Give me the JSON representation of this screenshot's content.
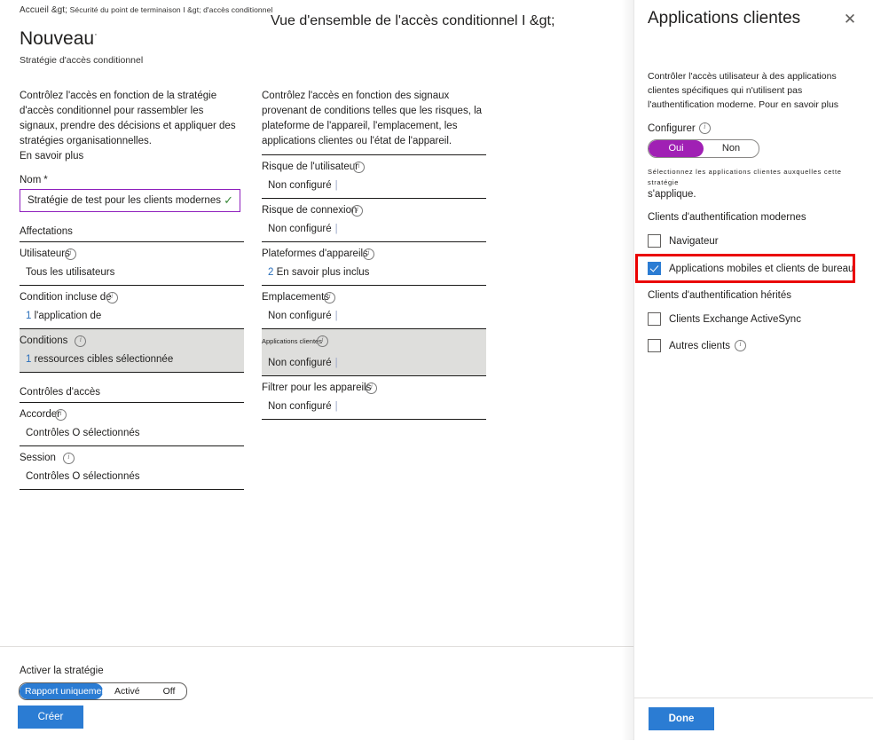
{
  "breadcrumb": {
    "home": "Accueil &gt;",
    "path": "Sécurité du point de terminaison I &gt; d'accès conditionnel"
  },
  "overview_title": "Vue d'ensemble de l'accès conditionnel I &gt;",
  "page": {
    "title": "Nouveau",
    "subtitle": "Stratégie d'accès conditionnel"
  },
  "left": {
    "description": "Contrôlez l'accès en fonction de la stratégie d'accès conditionnel pour rassembler les signaux, prendre des décisions et appliquer des stratégies organisationnelles.",
    "learn_more": "En savoir plus",
    "name_label": "Nom",
    "name_required": "*",
    "name_value": "Stratégie de test pour les clients modernes",
    "name_valid_icon": "checkmark-icon",
    "assignments_title": "Affectations",
    "rows": [
      {
        "label": "Utilisateurs",
        "value": "Tous les utilisateurs",
        "count": ""
      },
      {
        "label": "Condition incluse de",
        "value": "l'application de",
        "count": "1"
      },
      {
        "label": "Conditions",
        "value": "ressources cibles sélectionnée",
        "count": "1"
      }
    ],
    "access_controls_title": "Contrôles d'accès",
    "control_rows": [
      {
        "label": "Accorder",
        "value": "Contrôles O sélectionnés",
        "count": ""
      },
      {
        "label": "Session",
        "value": "Contrôles O sélectionnés",
        "count": ""
      }
    ]
  },
  "middle": {
    "description": "Contrôlez l'accès en fonction des signaux provenant de conditions telles que les risques, la plateforme de l'appareil, l'emplacement, les applications clientes ou l'état de l'appareil.",
    "rows": [
      {
        "label": "Risque de l'utilisateur",
        "value": "Non configuré",
        "count": "",
        "highlighted": false
      },
      {
        "label": "Risque de connexion",
        "value": "Non configuré",
        "count": "",
        "highlighted": false
      },
      {
        "label": "Plateformes d'appareils",
        "value": "En savoir plus inclus",
        "count": "2",
        "highlighted": false
      },
      {
        "label": "Emplacements",
        "value": "Non configuré",
        "count": "",
        "highlighted": false
      },
      {
        "label": "Applications clientes",
        "value": "Non configuré",
        "count": "",
        "highlighted": true
      },
      {
        "label": "Filtrer pour les appareils",
        "value": "Non configuré",
        "count": "",
        "highlighted": false
      }
    ]
  },
  "footer": {
    "enable_label": "Activer la stratégie",
    "segments": [
      "Rapport uniquement",
      "Activé",
      "Off"
    ],
    "selected_segment": "Rapport uniquement",
    "create_label": "Créer"
  },
  "panel": {
    "title": "Applications clientes",
    "close_icon": "close-icon",
    "description": "Contrôler l'accès utilisateur à des applications clientes spécifiques qui n'utilisent pas l'authentification moderne. Pour en savoir plus",
    "configure_label": "Configurer",
    "toggle": {
      "on": "Oui",
      "off": "Non",
      "selected": "Oui"
    },
    "hint_line1": "Sélectionnez les applications clientes auxquelles cette stratégie",
    "hint_line2": "s'applique.",
    "group_modern": "Clients d'authentification modernes",
    "group_legacy": "Clients d'authentification hérités",
    "checkboxes": [
      {
        "label": "Navigateur",
        "checked": false,
        "info": false,
        "highlighted": false
      },
      {
        "label": "Applications mobiles et clients de bureau",
        "checked": true,
        "info": false,
        "highlighted": true
      },
      {
        "label": "Clients Exchange ActiveSync",
        "checked": false,
        "info": false,
        "highlighted": false
      },
      {
        "label": "Autres clients",
        "checked": false,
        "info": true,
        "highlighted": false
      }
    ],
    "done_label": "Done"
  },
  "colors": {
    "accent_blue": "#2b7cd3",
    "toggle_purple": "#a020b4",
    "input_border_purple": "#8f1fbd",
    "valid_green": "#3a8a3a",
    "annotation_red": "#ea0000",
    "highlight_gray": "#dededc"
  }
}
